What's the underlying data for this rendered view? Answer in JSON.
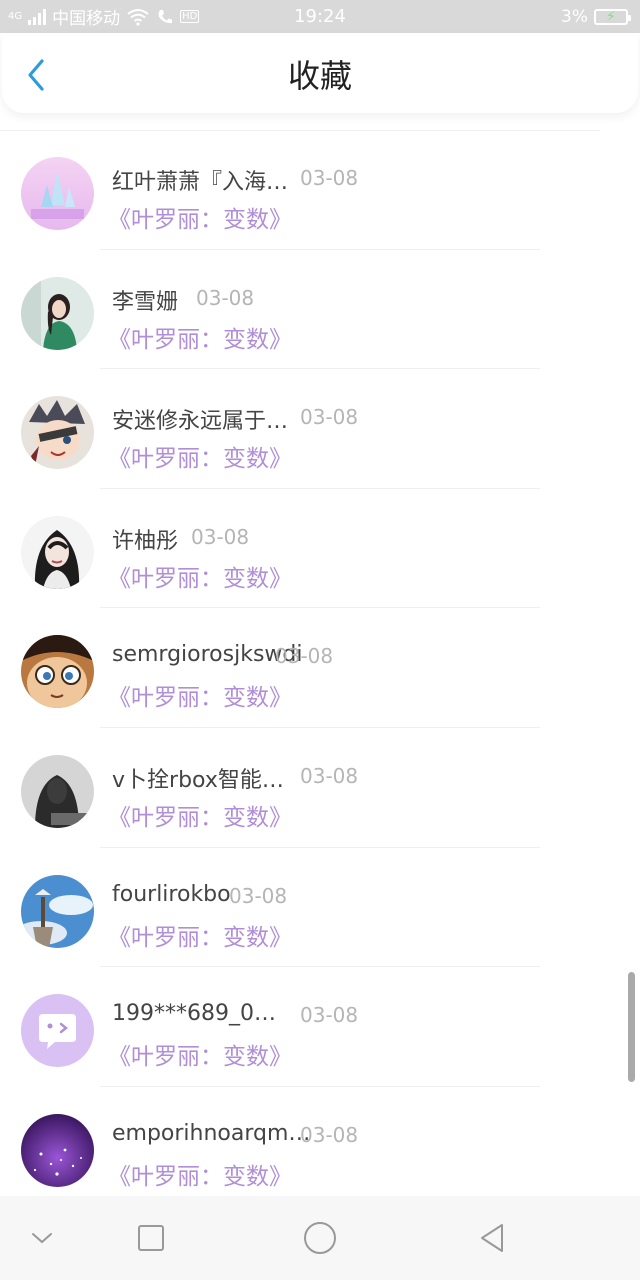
{
  "status_bar": {
    "network": "4G",
    "carrier": "中国移动",
    "hd": "HD",
    "time": "19:24",
    "battery": "3%"
  },
  "header": {
    "back_icon": "chevron-left-icon",
    "title": "收藏"
  },
  "favorites": [
    {
      "name": "红叶萧萧『入海…",
      "date": "03-08",
      "book": "《叶罗丽：变数》",
      "avatar": "fantasy-castle-avatar"
    },
    {
      "name": "李雪姗",
      "date": "03-08",
      "book": "《叶罗丽：变数》",
      "avatar": "girl-photo-avatar"
    },
    {
      "name": "安迷修永远属于…",
      "date": "03-08",
      "book": "《叶罗丽：变数》",
      "avatar": "anime-pirate-avatar"
    },
    {
      "name": "许柚彤",
      "date": "03-08",
      "book": "《叶罗丽：变数》",
      "avatar": "woman-portrait-avatar"
    },
    {
      "name": "semrgiorosjkswdi",
      "date": "03-08",
      "book": "《叶罗丽：变数》",
      "avatar": "anime-boy-avatar"
    },
    {
      "name": "v卜拴rbox智能…",
      "date": "03-08",
      "book": "《叶罗丽：变数》",
      "avatar": "grayscale-photo-avatar"
    },
    {
      "name": "fourlirokbo",
      "date": "03-08",
      "book": "《叶罗丽：变数》",
      "avatar": "sky-tower-avatar"
    },
    {
      "name": "199***689_0…",
      "date": "03-08",
      "book": "《叶罗丽：变数》",
      "avatar": "default-chat-avatar"
    },
    {
      "name": "emporihnoarqm…",
      "date": "03-08",
      "book": "《叶罗丽：变数》",
      "avatar": "purple-sparkle-avatar"
    }
  ],
  "nav_bar": {
    "buttons": [
      "chevron-down-icon",
      "recent-apps-icon",
      "home-icon",
      "back-triangle-icon"
    ]
  },
  "colors": {
    "book_title": "#b08fd8",
    "date": "#b5b5b5",
    "back_arrow": "#2d9cdb",
    "status_bar_bg": "#d9d9d9"
  }
}
